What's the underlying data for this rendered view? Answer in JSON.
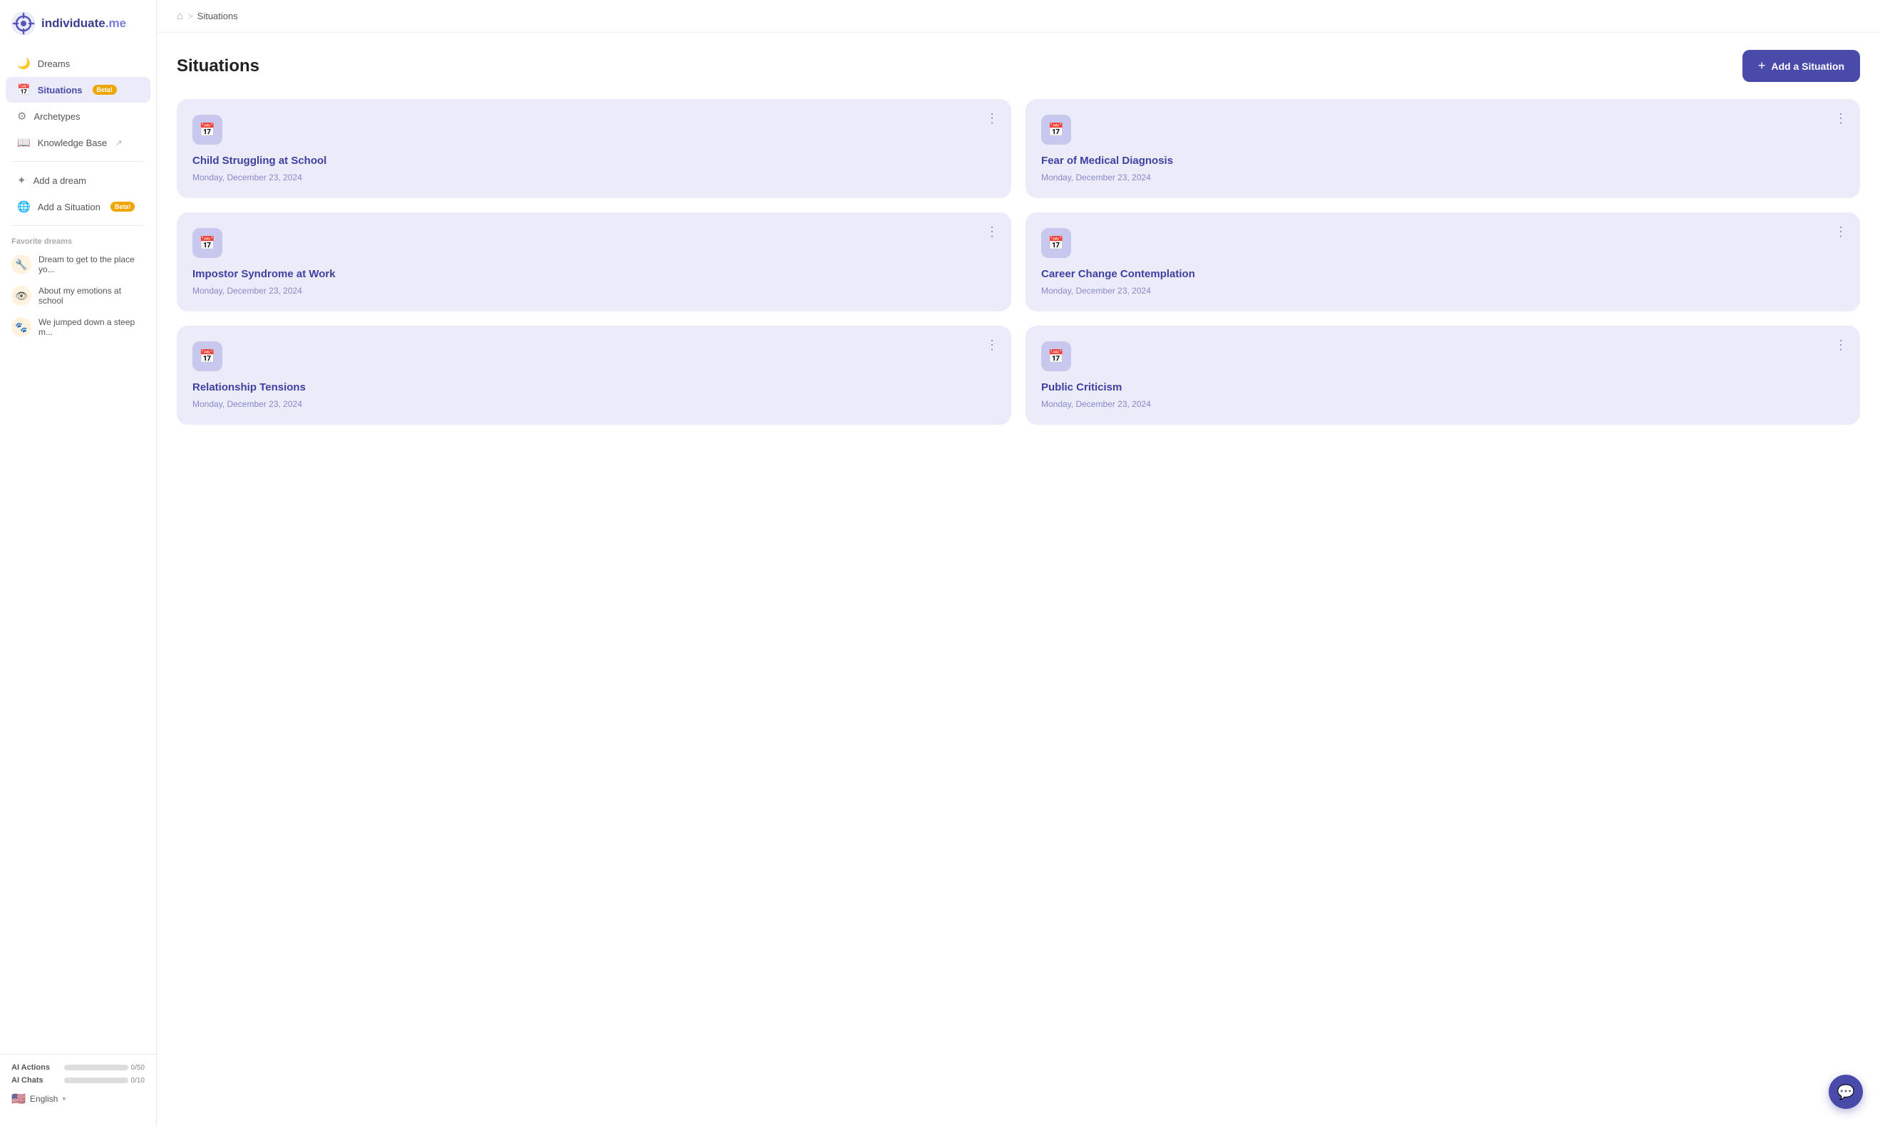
{
  "app": {
    "name": "individuate",
    "name_suffix": ".me"
  },
  "sidebar": {
    "nav_items": [
      {
        "id": "dreams",
        "label": "Dreams",
        "icon": "🌙",
        "active": false,
        "beta": false,
        "external": false
      },
      {
        "id": "situations",
        "label": "Situations",
        "icon": "📅",
        "active": true,
        "beta": true,
        "external": false
      },
      {
        "id": "archetypes",
        "label": "Archetypes",
        "icon": "⚙",
        "active": false,
        "beta": false,
        "external": false
      },
      {
        "id": "knowledge-base",
        "label": "Knowledge Base",
        "icon": "📖",
        "active": false,
        "beta": false,
        "external": true
      }
    ],
    "action_items": [
      {
        "id": "add-dream",
        "label": "Add a dream",
        "icon": "✦"
      },
      {
        "id": "add-situation",
        "label": "Add a Situation",
        "icon": "🌐",
        "beta": true
      }
    ],
    "section_label": "Favorite dreams",
    "favorites": [
      {
        "id": "fav1",
        "label": "Dream to get to the place yo...",
        "icon": "🔧",
        "icon_bg": "#fff3e0"
      },
      {
        "id": "fav2",
        "label": "About my emotions at school",
        "icon": "👁",
        "icon_bg": "#fff3e0"
      },
      {
        "id": "fav3",
        "label": "We jumped down a steep m...",
        "icon": "🐾",
        "icon_bg": "#fff3e0"
      }
    ],
    "ai_actions": {
      "label": "AI Actions",
      "value": "0/50",
      "progress": 0
    },
    "ai_chats": {
      "label": "AI Chats",
      "value": "0/10",
      "progress": 0
    },
    "language": {
      "label": "English",
      "flag": "🇺🇸"
    }
  },
  "breadcrumb": {
    "home_icon": "🏠",
    "separator": ">",
    "current": "Situations"
  },
  "page": {
    "title": "Situations",
    "add_button": "+ Add a Situation"
  },
  "situations": [
    {
      "id": "s1",
      "title": "Child Struggling at School",
      "date": "Monday, December 23, 2024"
    },
    {
      "id": "s2",
      "title": "Fear of Medical Diagnosis",
      "date": "Monday, December 23, 2024"
    },
    {
      "id": "s3",
      "title": "Impostor Syndrome at Work",
      "date": "Monday, December 23, 2024"
    },
    {
      "id": "s4",
      "title": "Career Change Contemplation",
      "date": "Monday, December 23, 2024"
    },
    {
      "id": "s5",
      "title": "Relationship Tensions",
      "date": "Monday, December 23, 2024"
    },
    {
      "id": "s6",
      "title": "Public Criticism",
      "date": "Monday, December 23, 2024"
    }
  ]
}
